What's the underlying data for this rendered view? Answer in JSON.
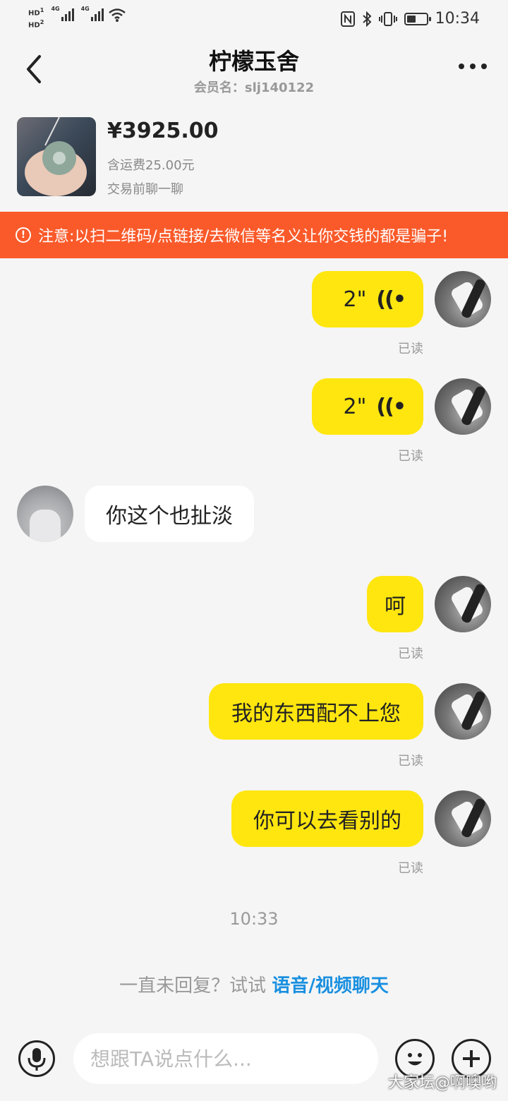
{
  "status_bar": {
    "hd1": "HD",
    "hd1_sub": "1",
    "hd2": "HD",
    "hd2_sub": "2",
    "net1": "4G",
    "net2": "4G",
    "time": "10:34"
  },
  "header": {
    "title": "柠檬玉舍",
    "member": "会员名：slj140122"
  },
  "product": {
    "price": "¥3925.00",
    "shipping": "含运费25.00元",
    "chat_before": "交易前聊一聊"
  },
  "warning": {
    "text": "注意:以扫二维码/点链接/去微信等名义让你交钱的都是骗子!"
  },
  "messages": [
    {
      "sender": "me",
      "kind": "voice",
      "duration": "2\"",
      "status": "已读"
    },
    {
      "sender": "me",
      "kind": "voice",
      "duration": "2\"",
      "status": "已读"
    },
    {
      "sender": "other",
      "kind": "text",
      "text": "你这个也扯淡"
    },
    {
      "sender": "me",
      "kind": "text",
      "text": "呵",
      "status": "已读"
    },
    {
      "sender": "me",
      "kind": "text",
      "text": "我的东西配不上您",
      "status": "已读"
    },
    {
      "sender": "me",
      "kind": "text",
      "text": "你可以去看别的",
      "status": "已读"
    }
  ],
  "timestamp": "10:33",
  "prompt": {
    "text": "一直未回复？试试 ",
    "link": "语音/视频聊天"
  },
  "input": {
    "placeholder": "想跟TA说点什么..."
  },
  "watermark": "大家坛@啊噢哟",
  "colors": {
    "bubble_me": "#ffe60f",
    "warning_bg": "#fa5a2a",
    "link": "#1a90e0"
  }
}
